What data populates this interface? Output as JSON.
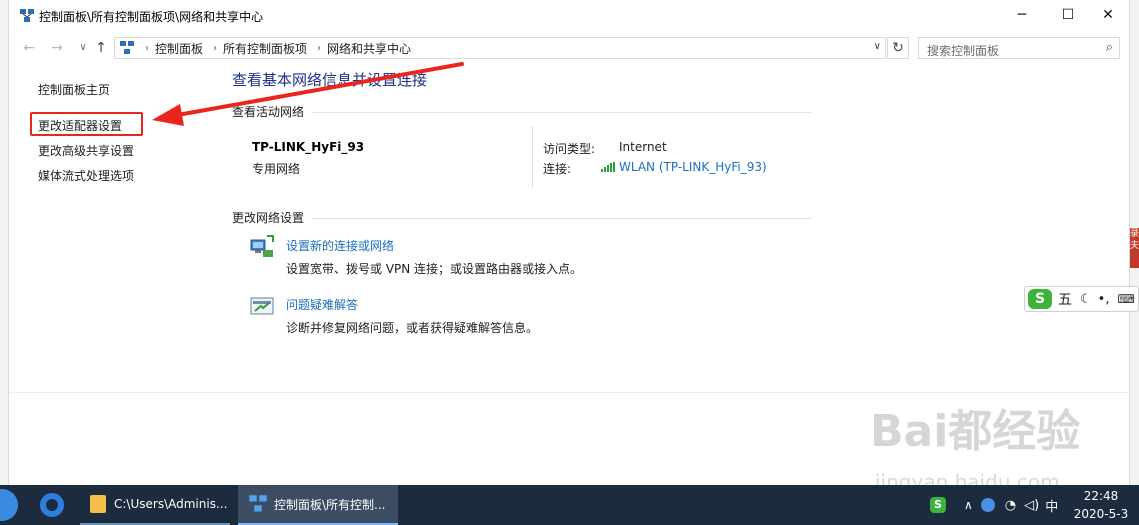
{
  "window": {
    "title": "控制面板\\所有控制面板项\\网络和共享中心",
    "minimize": "─",
    "maximize": "☐",
    "close": "✕"
  },
  "nav": {
    "back": "←",
    "forward": "→",
    "up": "↑",
    "breadcrumb": [
      "控制面板",
      "所有控制面板项",
      "网络和共享中心"
    ],
    "dropdown": "∨",
    "refresh": "↻",
    "search_placeholder": "搜索控制面板",
    "search_icon": "⌕"
  },
  "sidebar": {
    "items": [
      {
        "label": "控制面板主页"
      },
      {
        "label": "更改适配器设置"
      },
      {
        "label": "更改高级共享设置"
      },
      {
        "label": "媒体流式处理选项"
      }
    ]
  },
  "main": {
    "title": "查看基本网络信息并设置连接",
    "active_section": "查看活动网络",
    "network_name": "TP-LINK_HyFi_93",
    "network_type": "专用网络",
    "access_type_label": "访问类型:",
    "access_type_value": "Internet",
    "connection_label": "连接:",
    "connection_value": "WLAN (TP-LINK_HyFi_93)",
    "change_section": "更改网络设置",
    "tasks": [
      {
        "link": "设置新的连接或网络",
        "desc": "设置宽带、拨号或 VPN 连接；或设置路由器或接入点。",
        "icon": "network-setup-icon"
      },
      {
        "link": "问题疑难解答",
        "desc": "诊断并修复网络问题，或者获得疑难解答信息。",
        "icon": "troubleshoot-icon"
      }
    ]
  },
  "ime": {
    "logo": "S",
    "mode": "五",
    "moon": "☾",
    "dot": "•,",
    "keyboard": "⌨"
  },
  "taskbar": {
    "items": [
      {
        "label": "C:\\Users\\Adminis..."
      },
      {
        "label": "控制面板\\所有控制..."
      }
    ],
    "time": "22:48",
    "date": "2020-5-3"
  },
  "watermark": {
    "main": "Bai都经验",
    "sub": "jingyan.baidu.com"
  },
  "side_tab": {
    "text": "录夫"
  },
  "colors": {
    "link": "#1a6fc0",
    "title_blue": "#1e3287",
    "annotation_red": "#e8261d",
    "taskbar": "#1c2b3d"
  }
}
